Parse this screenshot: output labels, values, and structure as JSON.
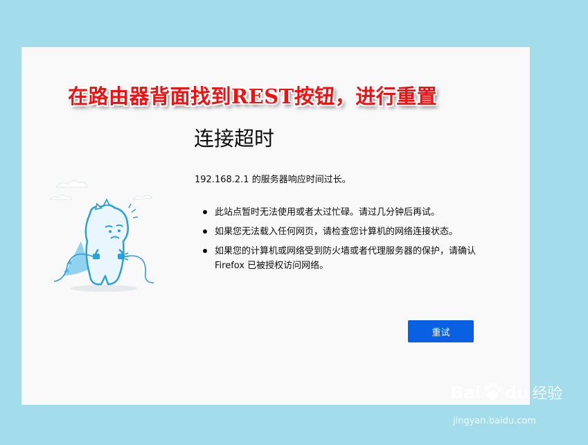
{
  "annotation": {
    "text": "在路由器背面找到REST按钮，进行重置",
    "color": "#ee1313"
  },
  "error_page": {
    "title": "连接超时",
    "description": "192.168.2.1 的服务器响应时间过长。",
    "reasons": [
      "此站点暂时无法使用或者太过忙碌。请过几分钟后再试。",
      "如果您无法载入任何网页，请检查您计算机的网络连接状态。",
      "如果您的计算机或网络受到防火墙或者代理服务器的保护，请确认 Firefox 已被授权访问网络。"
    ],
    "retry_label": "重试",
    "accent_color": "#0a60e3"
  },
  "illustration": {
    "icon": "unplugged-dinosaur-icon"
  },
  "watermark": {
    "brand_prefix": "Bai",
    "brand_suffix": "du",
    "brand_cn": "经验",
    "url": "jingyan.baidu.com"
  }
}
